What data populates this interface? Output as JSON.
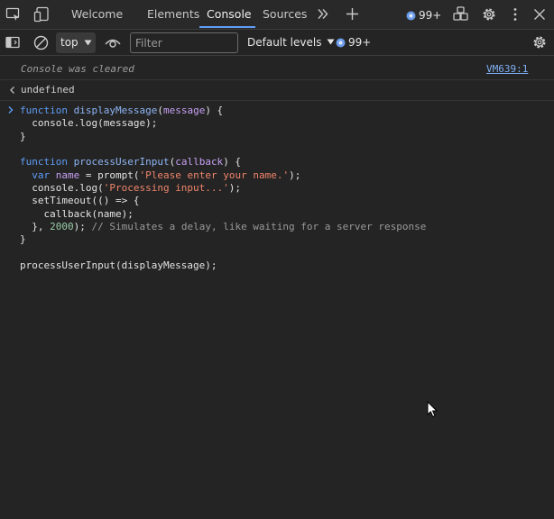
{
  "tabs": [
    {
      "label": "Welcome"
    },
    {
      "label": "Elements"
    },
    {
      "label": "Console"
    },
    {
      "label": "Sources"
    }
  ],
  "issues_badge_top": "99+",
  "issues_badge_toolbar": "99+",
  "context": "top",
  "filter": {
    "placeholder": "Filter",
    "value": ""
  },
  "levels_label": "Default levels",
  "console": {
    "cleared_message": "Console was cleared",
    "source_link": "VM639:1",
    "result_value": "undefined",
    "code": {
      "l1_kw": "function",
      "l1_name": "displayMessage",
      "l1_param": "message",
      "l2": "console.log(message);",
      "l5_kw": "function",
      "l5_name": "processUserInput",
      "l5_param": "callback",
      "l6_kw": "var",
      "l6_name": "name",
      "l6_fn": "prompt",
      "l6_str": "'Please enter your name.'",
      "l7_str": "'Processing input...'",
      "l9": "callback(name);",
      "l10_num": "2000",
      "l10_cmt": "// Simulates a delay, like waiting for a server response",
      "l13": "processUserInput(displayMessage);"
    }
  },
  "colors": {
    "accent": "#5e9df5",
    "string": "#f0856b",
    "number": "#9acca8",
    "comment": "#9a9a9a",
    "background": "#242424"
  },
  "icons": [
    "inspect-icon",
    "device-toolbar-icon",
    "more-tabs-icon",
    "add-tab-icon",
    "issues-icon",
    "customize-icon",
    "settings-icon",
    "more-options-icon",
    "close-icon",
    "sidebar-icon",
    "clear-console-icon",
    "eye-icon",
    "gear-icon",
    "prompt-chevron-icon",
    "result-arrow-icon",
    "dropdown-arrow-icon",
    "mouse-cursor-icon"
  ]
}
